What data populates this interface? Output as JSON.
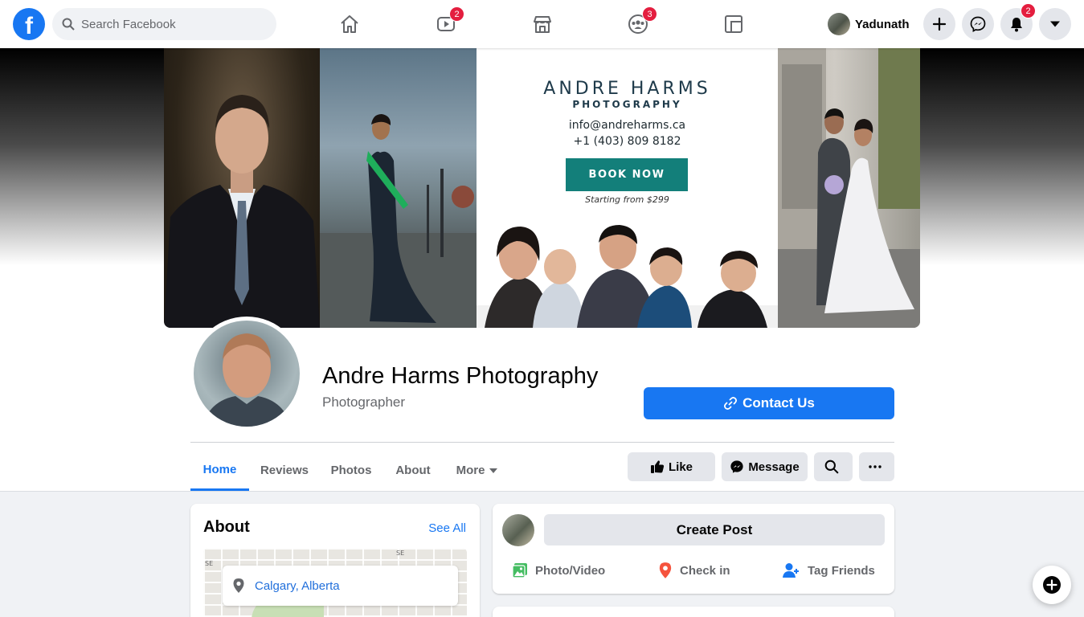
{
  "app": {
    "logo_letter": "f"
  },
  "search": {
    "placeholder": "Search Facebook"
  },
  "nav": {
    "items": [
      {
        "icon": "home-icon",
        "badge": ""
      },
      {
        "icon": "watch-icon",
        "badge": "2"
      },
      {
        "icon": "marketplace-icon",
        "badge": ""
      },
      {
        "icon": "groups-icon",
        "badge": "3"
      },
      {
        "icon": "gaming-icon",
        "badge": ""
      }
    ]
  },
  "user": {
    "name": "Yadunath",
    "notification_count": "2"
  },
  "cover": {
    "brand_name": "ANDRE HARMS",
    "brand_sub": "PHOTOGRAPHY",
    "email": "info@andreharms.ca",
    "phone": "+1 (403) 809 8182",
    "cta": "BOOK NOW",
    "starting": "Starting from $299"
  },
  "page": {
    "title": "Andre Harms Photography",
    "category": "Photographer",
    "contact_label": "Contact Us"
  },
  "tabs": [
    {
      "label": "Home",
      "active": true
    },
    {
      "label": "Reviews"
    },
    {
      "label": "Photos"
    },
    {
      "label": "About"
    },
    {
      "label": "More"
    }
  ],
  "actions": {
    "like": "Like",
    "message": "Message"
  },
  "about": {
    "title": "About",
    "see_all": "See All",
    "location": "Calgary, Alberta",
    "map_tags": [
      "SE",
      "SE"
    ]
  },
  "composer": {
    "create_post": "Create Post",
    "photo_video": "Photo/Video",
    "check_in": "Check in",
    "tag_friends": "Tag Friends"
  },
  "colors": {
    "accent": "#1877f2",
    "badge": "#e41e3f",
    "book_button": "#137f7a"
  }
}
